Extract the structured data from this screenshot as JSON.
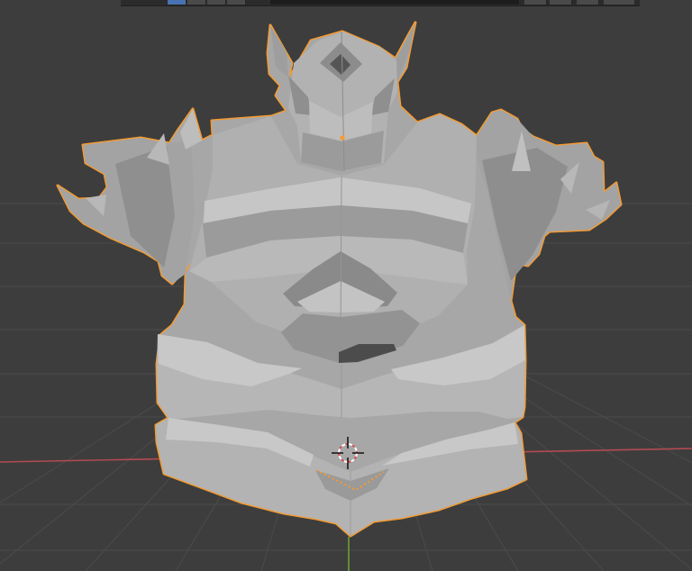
{
  "viewport": {
    "label": "3D Viewport",
    "background": "#3d3d3d",
    "grid_color": "#4a4a4a",
    "x_axis_color": "#b34a52",
    "y_axis_color": "#6fa12f",
    "selection_outline_color": "#f59b30",
    "mesh_color": "#a9a9a9"
  },
  "header": {
    "visible_controls": [
      "view-controls",
      "active-tool",
      "search-field",
      "display-controls"
    ]
  },
  "object": {
    "name": "",
    "kind": "armor-mesh",
    "selected": true
  },
  "cursor": {
    "icon": "3d-cursor-icon"
  },
  "origin": {
    "icon": "object-origin-icon"
  }
}
